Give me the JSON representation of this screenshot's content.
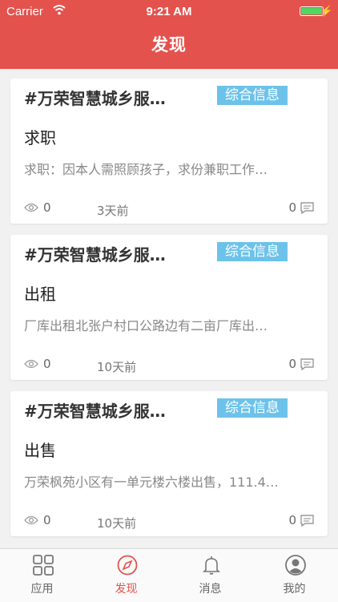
{
  "status_bar": {
    "carrier": "Carrier",
    "time": "9:21 AM",
    "battery_level": 1.0
  },
  "header": {
    "title": "发现"
  },
  "colors": {
    "brand": "#e4524d",
    "tag": "#6cc2ea",
    "battery": "#4cd964"
  },
  "posts": [
    {
      "org": "#万荣智慧城乡服…",
      "tag": "综合信息",
      "title": "求职",
      "desc": "求职：因本人需照顾孩子，求份兼职工作…",
      "views": "0",
      "date": "3天前",
      "comments": "0"
    },
    {
      "org": "#万荣智慧城乡服…",
      "tag": "综合信息",
      "title": "出租",
      "desc": "厂库出租北张户村口公路边有二亩厂库出…",
      "views": "0",
      "date": "10天前",
      "comments": "0"
    },
    {
      "org": "#万荣智慧城乡服…",
      "tag": "综合信息",
      "title": "出售",
      "desc": "万荣枫苑小区有一单元楼六楼出售，111.4…",
      "views": "0",
      "date": "10天前",
      "comments": "0"
    }
  ],
  "tabbar": {
    "items": [
      {
        "label": "应用",
        "icon": "grid-icon"
      },
      {
        "label": "发现",
        "icon": "compass-icon",
        "active": true
      },
      {
        "label": "消息",
        "icon": "bell-icon"
      },
      {
        "label": "我的",
        "icon": "user-icon"
      }
    ]
  }
}
